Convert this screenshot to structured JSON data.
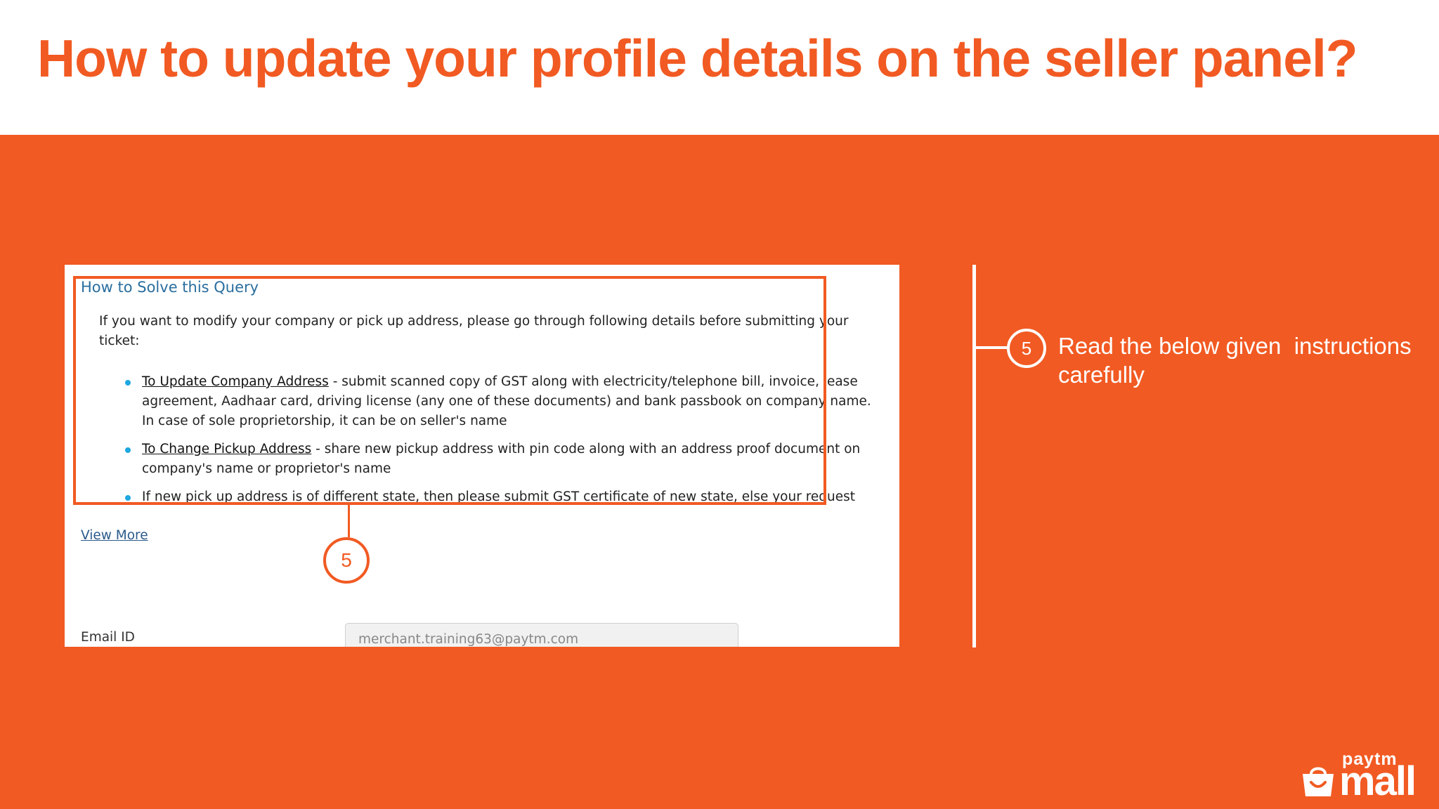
{
  "slide": {
    "title": "How to update your profile details on the seller panel?"
  },
  "screenshot": {
    "heading": "How to Solve this Query",
    "intro": "If you want to modify your company or pick up address, please go through following details before submitting your ticket:",
    "bullets": [
      {
        "label": "To Update Company Address",
        "text": " - submit scanned copy of GST along with electricity/telephone bill, invoice, lease agreement, Aadhaar card, driving license (any one of these documents) and bank passbook on company name. In case of sole proprietorship, it can be on seller's name"
      },
      {
        "label": "To Change Pickup Address",
        "text": " - share new pickup address with pin code along with an address proof document on company's name or proprietor's name"
      },
      {
        "label": "",
        "text": "If new pick up address is of different state, then please submit GST certificate of new state, else your request"
      }
    ],
    "view_more": "View More",
    "step_badge": "5",
    "email_label": "Email ID",
    "email_value": "merchant.training63@paytm.com"
  },
  "callout": {
    "step_number": "5",
    "instruction": "Read the below given  instructions carefully"
  },
  "logo": {
    "top": "paytm",
    "bottom": "mall"
  },
  "colors": {
    "brand_orange": "#f15a22",
    "heading_blue": "#2a6e9e",
    "bullet_blue": "#1ea7e1",
    "white": "#ffffff"
  }
}
